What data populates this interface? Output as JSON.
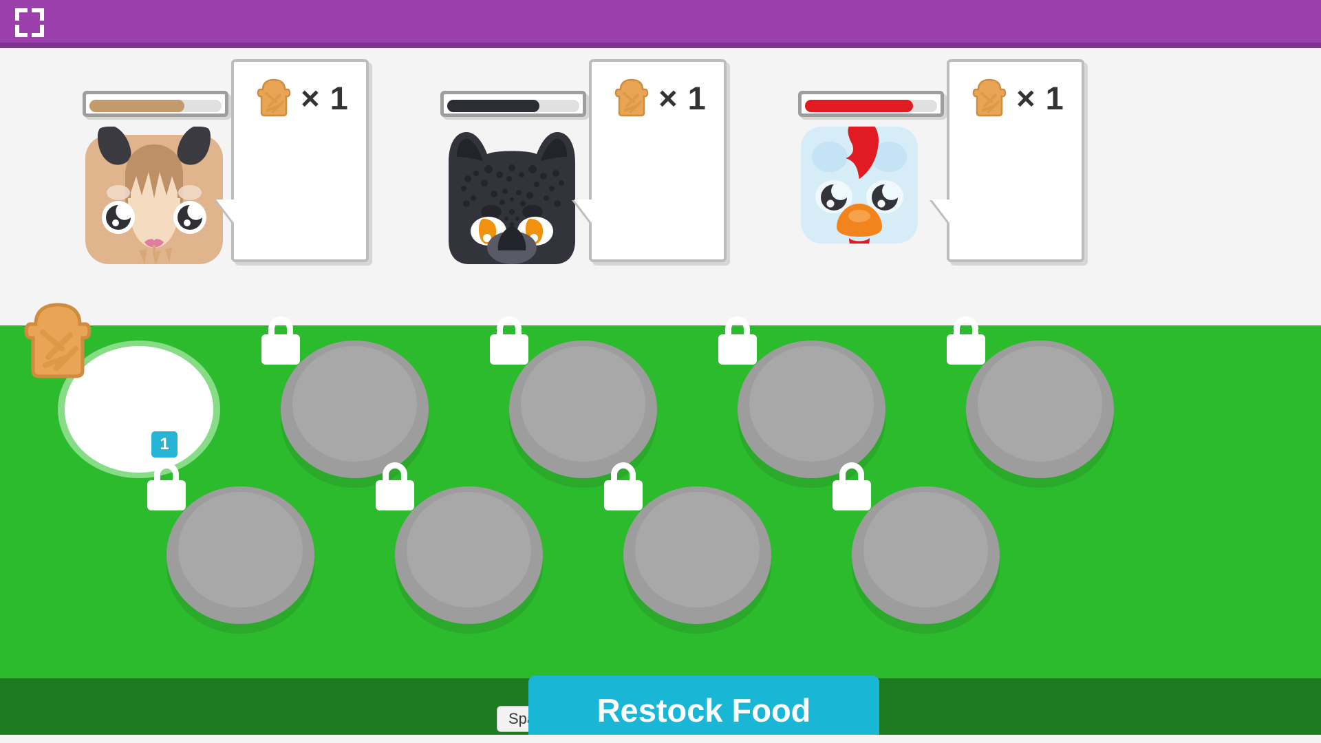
{
  "topbar": {
    "color": "#9b3fad",
    "fullscreen_icon": "fullscreen-icon"
  },
  "animals": [
    {
      "name": "llama",
      "species_label": "Llama",
      "hunger_percent": 72,
      "hunger_color": "#c49a6c",
      "request": {
        "food_icon": "toast-icon",
        "quantity_label": "× 1",
        "quantity": 1
      }
    },
    {
      "name": "panther",
      "species_label": "Black Panther",
      "hunger_percent": 70,
      "hunger_color": "#2c2c34",
      "request": {
        "food_icon": "toast-icon",
        "quantity_label": "× 1",
        "quantity": 1
      }
    },
    {
      "name": "chicken",
      "species_label": "Chicken",
      "hunger_percent": 82,
      "hunger_color": "#e01b22",
      "request": {
        "food_icon": "toast-icon",
        "quantity_label": "× 1",
        "quantity": 1
      }
    }
  ],
  "food_area": {
    "background_color": "#2cbb2c",
    "slots": [
      {
        "state": "unlocked",
        "food_icon": "toast-icon",
        "count_label": "1",
        "row": 0,
        "col": 0
      },
      {
        "state": "locked",
        "lock_icon": "lock-icon",
        "row": 0,
        "col": 1
      },
      {
        "state": "locked",
        "lock_icon": "lock-icon",
        "row": 0,
        "col": 2
      },
      {
        "state": "locked",
        "lock_icon": "lock-icon",
        "row": 0,
        "col": 3
      },
      {
        "state": "locked",
        "lock_icon": "lock-icon",
        "row": 0,
        "col": 4
      },
      {
        "state": "locked",
        "lock_icon": "lock-icon",
        "row": 1,
        "col": 0
      },
      {
        "state": "locked",
        "lock_icon": "lock-icon",
        "row": 1,
        "col": 1
      },
      {
        "state": "locked",
        "lock_icon": "lock-icon",
        "row": 1,
        "col": 2
      },
      {
        "state": "locked",
        "lock_icon": "lock-icon",
        "row": 1,
        "col": 3
      }
    ]
  },
  "footer": {
    "restock_label": "Restock Food",
    "restock_color": "#1ab6d6",
    "shortcut_key_label": "Space"
  }
}
